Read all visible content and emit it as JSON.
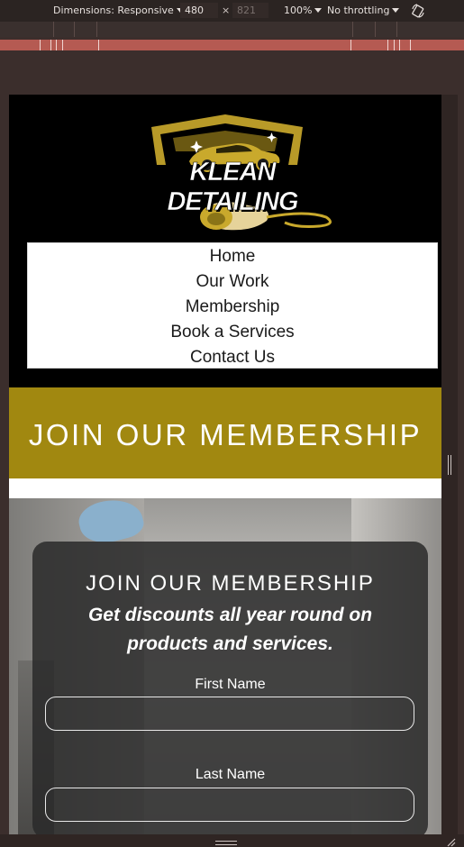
{
  "devtools": {
    "dimensions_label": "Dimensions: Responsive",
    "width_value": "480",
    "times": "×",
    "height_value": "821",
    "zoom": "100%",
    "throttling": "No throttling",
    "icons": {
      "caret": "caret-down-icon",
      "rotate": "rotate-icon"
    }
  },
  "site": {
    "logo_text": "KLEAN DETAILING",
    "nav": [
      "Home",
      "Our Work",
      "Membership",
      "Book a Services",
      "Contact Us"
    ],
    "banner_title": "JOIN OUR MEMBERSHIP",
    "form": {
      "title": "JOIN OUR MEMBERSHIP",
      "subtitle": "Get discounts all year round on products and services.",
      "first_name_label": "First Name",
      "last_name_label": "Last Name",
      "first_name_value": "",
      "last_name_value": ""
    }
  },
  "colors": {
    "brand_gold": "#a18810",
    "logo_gold": "#b89a28",
    "header_bg": "#000000",
    "panel_bg": "rgba(42,42,42,0.86)"
  }
}
